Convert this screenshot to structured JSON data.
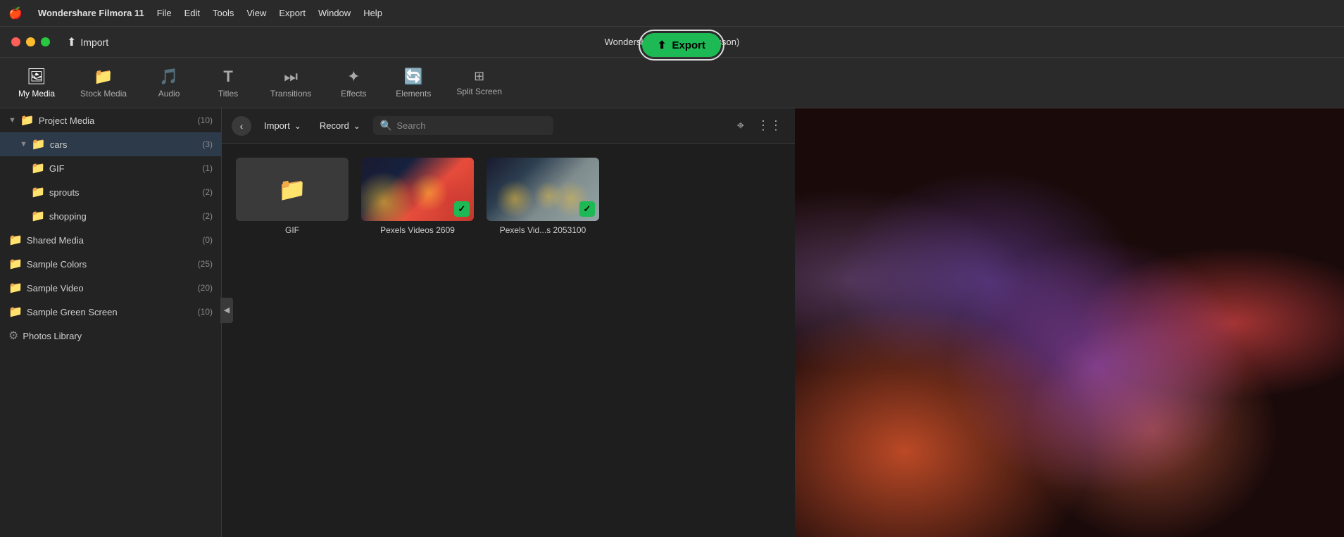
{
  "app": {
    "name": "Wondershare Filmora 11",
    "window_title": "Wondershare Filmora 11 (lesson)"
  },
  "menu": {
    "apple": "🍎",
    "items": [
      "File",
      "Edit",
      "Tools",
      "View",
      "Export",
      "Window",
      "Help"
    ]
  },
  "traffic_lights": {
    "red_label": "close",
    "yellow_label": "minimize",
    "green_label": "maximize"
  },
  "header": {
    "import_label": "Import",
    "export_label": "Export"
  },
  "nav": {
    "items": [
      {
        "id": "my-media",
        "label": "My Media",
        "icon": "🖼"
      },
      {
        "id": "stock-media",
        "label": "Stock Media",
        "icon": "📁"
      },
      {
        "id": "audio",
        "label": "Audio",
        "icon": "🎵"
      },
      {
        "id": "titles",
        "label": "Titles",
        "icon": "T"
      },
      {
        "id": "transitions",
        "label": "Transitions",
        "icon": "⏭"
      },
      {
        "id": "effects",
        "label": "Effects",
        "icon": "✦"
      },
      {
        "id": "elements",
        "label": "Elements",
        "icon": "🔄"
      },
      {
        "id": "split-screen",
        "label": "Split Screen",
        "icon": "⊞"
      }
    ]
  },
  "sidebar": {
    "project_media": {
      "label": "Project Media",
      "count": 10
    },
    "cars": {
      "label": "cars",
      "count": 3
    },
    "gif": {
      "label": "GIF",
      "count": 1
    },
    "sprouts": {
      "label": "sprouts",
      "count": 2
    },
    "shopping": {
      "label": "shopping",
      "count": 2
    },
    "shared_media": {
      "label": "Shared Media",
      "count": 0
    },
    "sample_colors": {
      "label": "Sample Colors",
      "count": 25
    },
    "sample_video": {
      "label": "Sample Video",
      "count": 20
    },
    "sample_green_screen": {
      "label": "Sample Green Screen",
      "count": 10
    },
    "photos_library": {
      "label": "Photos Library"
    }
  },
  "toolbar": {
    "import_label": "Import",
    "record_label": "Record",
    "search_placeholder": "Search",
    "back_icon": "‹"
  },
  "media_items": [
    {
      "id": "gif",
      "label": "GIF",
      "type": "folder"
    },
    {
      "id": "pexels1",
      "label": "Pexels Videos 2609",
      "type": "video",
      "checked": true
    },
    {
      "id": "pexels2",
      "label": "Pexels Vid...s 2053100",
      "type": "video",
      "checked": true
    }
  ],
  "icons": {
    "search": "🔍",
    "filter": "⌖",
    "grid": "⋮⋮",
    "chevron_down": "⌄",
    "share": "⬆",
    "folder": "📁",
    "gear": "⚙",
    "check": "✓",
    "back": "‹",
    "collapse": "◀"
  },
  "colors": {
    "accent_green": "#1db954",
    "sidebar_selected": "#2d3a4a",
    "bg_dark": "#1e1e1e",
    "bg_medium": "#232323",
    "bg_light": "#2a2a2a"
  }
}
